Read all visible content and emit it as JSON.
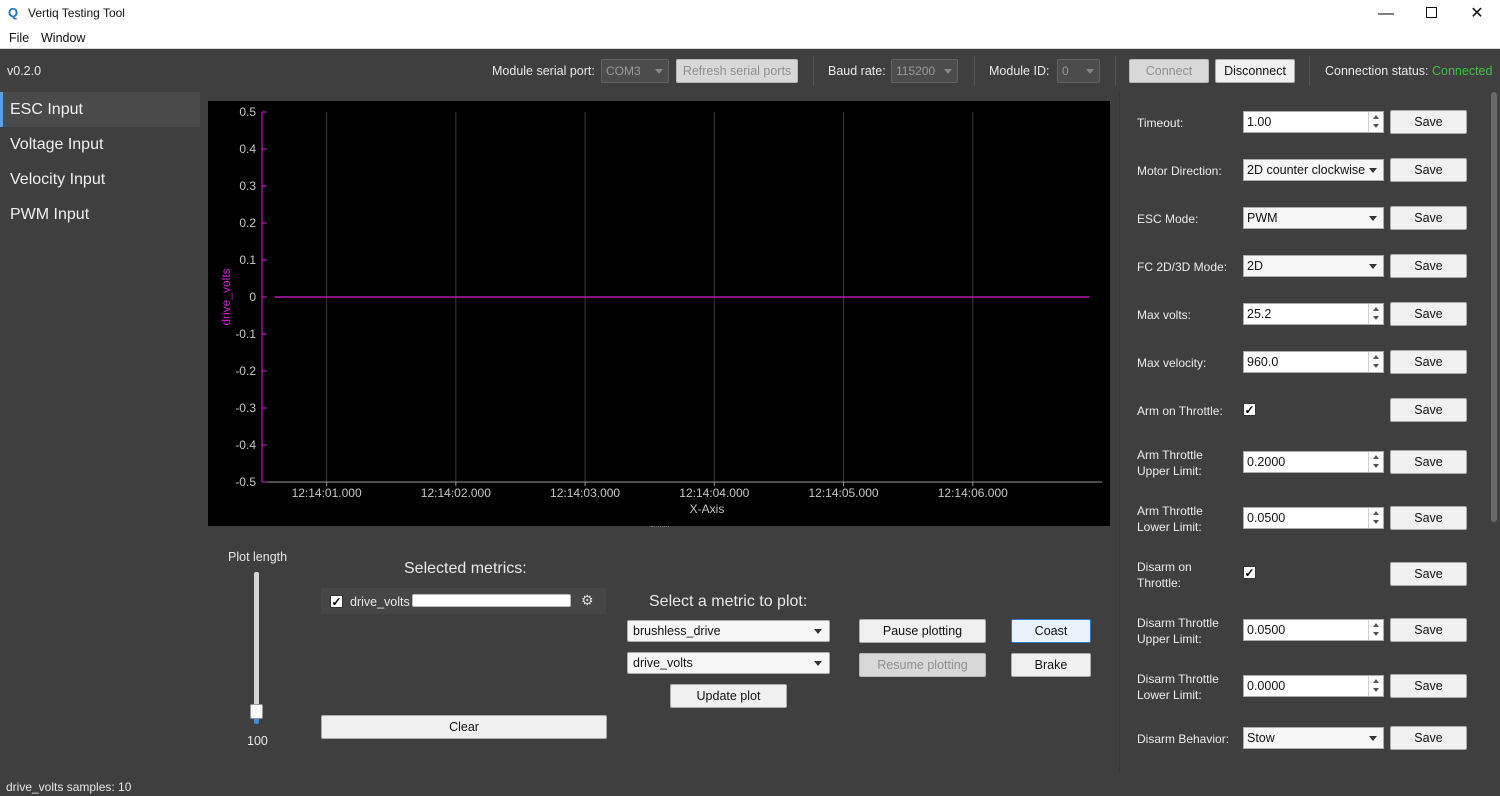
{
  "window": {
    "title": "Vertiq Testing Tool",
    "minimize": "—",
    "close": "✕"
  },
  "menu": {
    "file": "File",
    "window": "Window"
  },
  "toolbar": {
    "version": "v0.2.0",
    "serial_port_label": "Module serial port:",
    "serial_port_value": "COM3",
    "refresh_label": "Refresh serial ports",
    "baud_label": "Baud rate:",
    "baud_value": "115200",
    "module_id_label": "Module ID:",
    "module_id_value": "0",
    "connect_label": "Connect",
    "disconnect_label": "Disconnect",
    "status_label": "Connection status:",
    "status_value": "Connected",
    "status_color": "#3ec43e"
  },
  "sidebar": {
    "items": [
      {
        "label": "ESC Input"
      },
      {
        "label": "Voltage Input"
      },
      {
        "label": "Velocity Input"
      },
      {
        "label": "PWM Input"
      }
    ]
  },
  "chart_data": {
    "type": "line",
    "xlabel": "X-Axis",
    "ylabel": "drive_volts",
    "x_ticks": [
      "12:14:01.000",
      "12:14:02.000",
      "12:14:03.000",
      "12:14:04.000",
      "12:14:05.000",
      "12:14:06.000"
    ],
    "x_range_seconds": [
      0.5,
      7.0
    ],
    "ylim": [
      -0.5,
      0.5
    ],
    "y_ticks": [
      0.5,
      0.4,
      0.3,
      0.2,
      0.1,
      0,
      -0.1,
      -0.2,
      -0.3,
      -0.4,
      -0.5
    ],
    "grid": "x",
    "series": [
      {
        "name": "drive_volts",
        "color": "#d21fd2",
        "x": [
          0.6,
          1.3,
          2.0,
          2.7,
          3.4,
          4.1,
          4.8,
          5.5,
          6.2,
          6.9
        ],
        "y": [
          0,
          0,
          0,
          0,
          0,
          0,
          0,
          0,
          0,
          0
        ]
      }
    ]
  },
  "bottom": {
    "plot_length_label": "Plot length",
    "plot_length_value": "100",
    "plot_length_level": 1.0,
    "selected_metrics_title": "Selected metrics:",
    "selected_metric": {
      "name": "drive_volts",
      "checked": "✓"
    },
    "clear_label": "Clear",
    "select_metric_title": "Select a metric to plot:",
    "module_select": "brushless_drive",
    "metric_select": "drive_volts",
    "update_plot_label": "Update plot",
    "pause_label": "Pause plotting",
    "resume_label": "Resume plotting",
    "coast_label": "Coast",
    "brake_label": "Brake"
  },
  "settings": {
    "save_label": "Save",
    "rows": [
      {
        "label": "Timeout:",
        "value": "1.00"
      },
      {
        "label": "Motor Direction:",
        "value": "2D counter clockwise"
      },
      {
        "label": "ESC Mode:",
        "value": "PWM"
      },
      {
        "label": "FC 2D/3D Mode:",
        "value": "2D"
      },
      {
        "label": "Max volts:",
        "value": "25.2"
      },
      {
        "label": "Max velocity:",
        "value": "960.0"
      },
      {
        "label": "Arm on Throttle:",
        "value": "✓"
      },
      {
        "label": "Arm Throttle Upper Limit:",
        "value": "0.2000"
      },
      {
        "label": "Arm Throttle Lower Limit:",
        "value": "0.0500"
      },
      {
        "label": "Disarm on Throttle:",
        "value": "✓"
      },
      {
        "label": "Disarm Throttle Upper Limit:",
        "value": "0.0500"
      },
      {
        "label": "Disarm Throttle Lower Limit:",
        "value": "0.0000"
      },
      {
        "label": "Disarm Behavior:",
        "value": "Stow"
      }
    ]
  },
  "status": {
    "text": "drive_volts samples: 10"
  }
}
